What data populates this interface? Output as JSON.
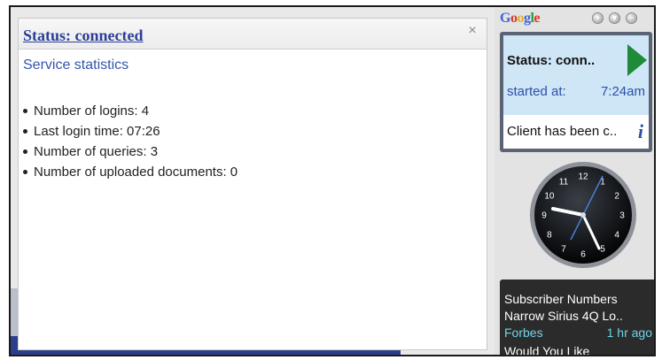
{
  "popup": {
    "title": "Status: connected",
    "close_glyph": "×",
    "subtitle": "Service statistics",
    "stats": [
      "Number of logins: 4",
      "Last login time: 07:26",
      "Number of queries: 3",
      "Number of uploaded documents: 0"
    ]
  },
  "sidebar": {
    "logo": "Google",
    "header_buttons": [
      "add-icon",
      "options-icon",
      "minimize-icon"
    ],
    "status_gadget": {
      "title": "Status: conn..",
      "started_label": "started at:",
      "started_time": "7:24am",
      "client_text": "Client has been c..",
      "info_glyph": "i"
    },
    "clock": {
      "numbers": [
        "12",
        "1",
        "2",
        "3",
        "4",
        "5",
        "6",
        "7",
        "8",
        "9",
        "10",
        "11"
      ]
    },
    "news": {
      "line1": "Subscriber Numbers",
      "line2": "Narrow Sirius 4Q Lo..",
      "source": "Forbes",
      "age": "1 hr ago",
      "line4": "Would You Like"
    }
  },
  "colors": {
    "title_blue": "#2b3f97",
    "status_bg": "#cfe6f6",
    "play_green": "#1f8a3a",
    "news_bg": "#2b2b2b",
    "news_source": "#6fd4e8"
  }
}
